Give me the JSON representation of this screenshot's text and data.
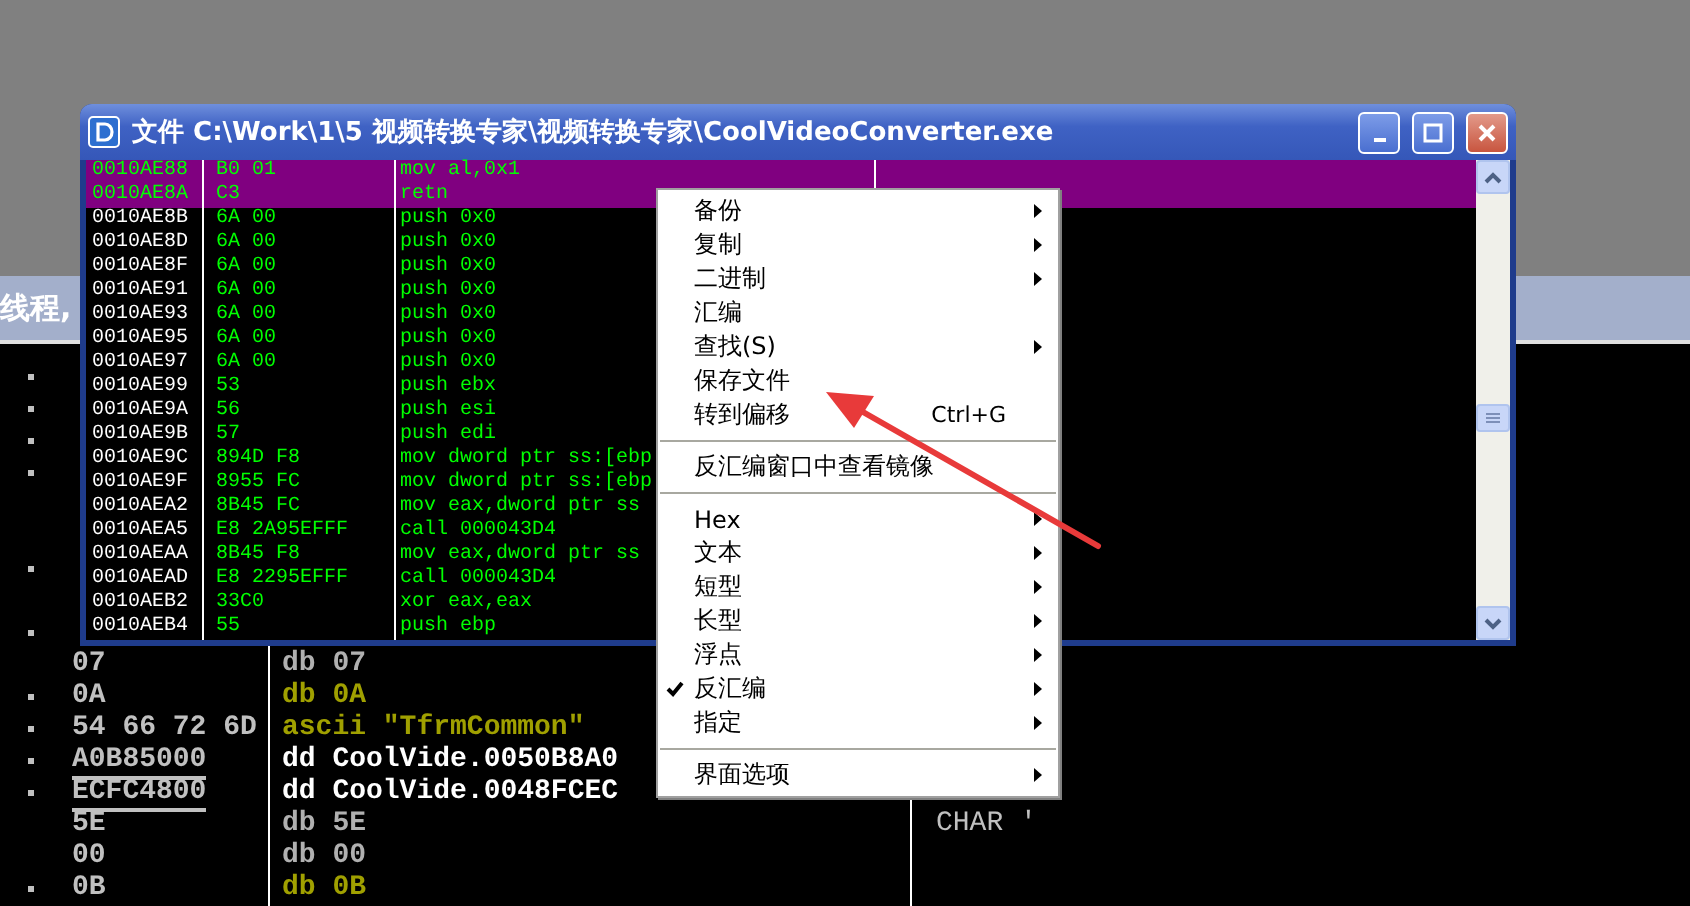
{
  "background_window": {
    "header_text": "线程,",
    "rows": [
      {
        "marked": true
      },
      {
        "marked": true
      },
      {
        "marked": true
      },
      {
        "marked": true
      },
      {
        "marked": false
      },
      {
        "marked": false
      },
      {
        "marked": true
      },
      {
        "marked": false
      },
      {
        "marked": true
      },
      {
        "marked": false,
        "hex": "07",
        "code": "db 07",
        "kind": "byte",
        "underlined": false
      },
      {
        "marked": true,
        "hex": "0A",
        "code": "db 0A",
        "kind": "data",
        "underlined": false
      },
      {
        "marked": true,
        "hex": "54 66 72 6D",
        "code": "ascii \"TfrmCommon\"",
        "kind": "data",
        "underlined": false
      },
      {
        "marked": true,
        "hex": "A0B85000",
        "code": "dd CoolVide.0050B8A0",
        "kind": "pointer",
        "underlined": true
      },
      {
        "marked": true,
        "hex": "ECFC4800",
        "code": "dd CoolVide.0048FCEC",
        "kind": "pointer",
        "underlined": true
      },
      {
        "marked": false,
        "hex": "5E",
        "code": "db 5E",
        "kind": "byte",
        "underlined": false,
        "comment": "CHAR '"
      },
      {
        "marked": false,
        "hex": "00",
        "code": "db 00",
        "kind": "byte",
        "underlined": false
      },
      {
        "marked": true,
        "hex": "0B",
        "code": "db 0B",
        "kind": "data",
        "underlined": false
      }
    ]
  },
  "window": {
    "title": "文件 C:\\Work\\1\\5 视频转换专家\\视频转换专家\\CoolVideoConverter.exe",
    "rows": [
      {
        "address": "0010AE88",
        "bytes": "B0 01",
        "code": "mov al,0x1",
        "selected": true
      },
      {
        "address": "0010AE8A",
        "bytes": "C3",
        "code": "retn",
        "selected": true
      },
      {
        "address": "0010AE8B",
        "bytes": "6A 00",
        "code": "push 0x0",
        "selected": false
      },
      {
        "address": "0010AE8D",
        "bytes": "6A 00",
        "code": "push 0x0",
        "selected": false
      },
      {
        "address": "0010AE8F",
        "bytes": "6A 00",
        "code": "push 0x0",
        "selected": false
      },
      {
        "address": "0010AE91",
        "bytes": "6A 00",
        "code": "push 0x0",
        "selected": false
      },
      {
        "address": "0010AE93",
        "bytes": "6A 00",
        "code": "push 0x0",
        "selected": false
      },
      {
        "address": "0010AE95",
        "bytes": "6A 00",
        "code": "push 0x0",
        "selected": false
      },
      {
        "address": "0010AE97",
        "bytes": "6A 00",
        "code": "push 0x0",
        "selected": false
      },
      {
        "address": "0010AE99",
        "bytes": "53",
        "code": "push ebx",
        "selected": false
      },
      {
        "address": "0010AE9A",
        "bytes": "56",
        "code": "push esi",
        "selected": false
      },
      {
        "address": "0010AE9B",
        "bytes": "57",
        "code": "push edi",
        "selected": false
      },
      {
        "address": "0010AE9C",
        "bytes": "894D F8",
        "code": "mov dword ptr ss:[ebp",
        "selected": false
      },
      {
        "address": "0010AE9F",
        "bytes": "8955 FC",
        "code": "mov dword ptr ss:[ebp",
        "selected": false
      },
      {
        "address": "0010AEA2",
        "bytes": "8B45 FC",
        "code": "mov eax,dword ptr ss",
        "selected": false
      },
      {
        "address": "0010AEA5",
        "bytes": "E8 2A95EFFF",
        "code": "call 000043D4",
        "selected": false
      },
      {
        "address": "0010AEAA",
        "bytes": "8B45 F8",
        "code": "mov eax,dword ptr ss",
        "selected": false
      },
      {
        "address": "0010AEAD",
        "bytes": "E8 2295EFFF",
        "code": "call 000043D4",
        "selected": false
      },
      {
        "address": "0010AEB2",
        "bytes": "33C0",
        "code": "xor eax,eax",
        "selected": false
      },
      {
        "address": "0010AEB4",
        "bytes": "55",
        "code": "push ebp",
        "selected": false
      }
    ]
  },
  "context_menu": {
    "items": [
      {
        "kind": "item",
        "label": "备份",
        "submenu": true,
        "checked": false
      },
      {
        "kind": "item",
        "label": "复制",
        "submenu": true,
        "checked": false
      },
      {
        "kind": "item",
        "label": "二进制",
        "submenu": true,
        "checked": false
      },
      {
        "kind": "item",
        "label": "汇编",
        "submenu": false,
        "checked": false
      },
      {
        "kind": "item",
        "label": "查找(S)",
        "submenu": true,
        "checked": false
      },
      {
        "kind": "item",
        "label": "保存文件",
        "submenu": false,
        "checked": false
      },
      {
        "kind": "item",
        "label": "转到偏移",
        "shortcut": "Ctrl+G",
        "submenu": false,
        "checked": false
      },
      {
        "kind": "separator"
      },
      {
        "kind": "item",
        "label": "反汇编窗口中查看镜像",
        "submenu": false,
        "checked": false
      },
      {
        "kind": "separator"
      },
      {
        "kind": "item",
        "label": "Hex",
        "submenu": true,
        "checked": false
      },
      {
        "kind": "item",
        "label": "文本",
        "submenu": true,
        "checked": false
      },
      {
        "kind": "item",
        "label": "短型",
        "submenu": true,
        "checked": false
      },
      {
        "kind": "item",
        "label": "长型",
        "submenu": true,
        "checked": false
      },
      {
        "kind": "item",
        "label": "浮点",
        "submenu": true,
        "checked": false
      },
      {
        "kind": "item",
        "label": "反汇编",
        "submenu": true,
        "checked": true
      },
      {
        "kind": "item",
        "label": "指定",
        "submenu": true,
        "checked": false
      },
      {
        "kind": "separator"
      },
      {
        "kind": "item",
        "label": "界面选项",
        "submenu": true,
        "checked": false
      }
    ]
  }
}
